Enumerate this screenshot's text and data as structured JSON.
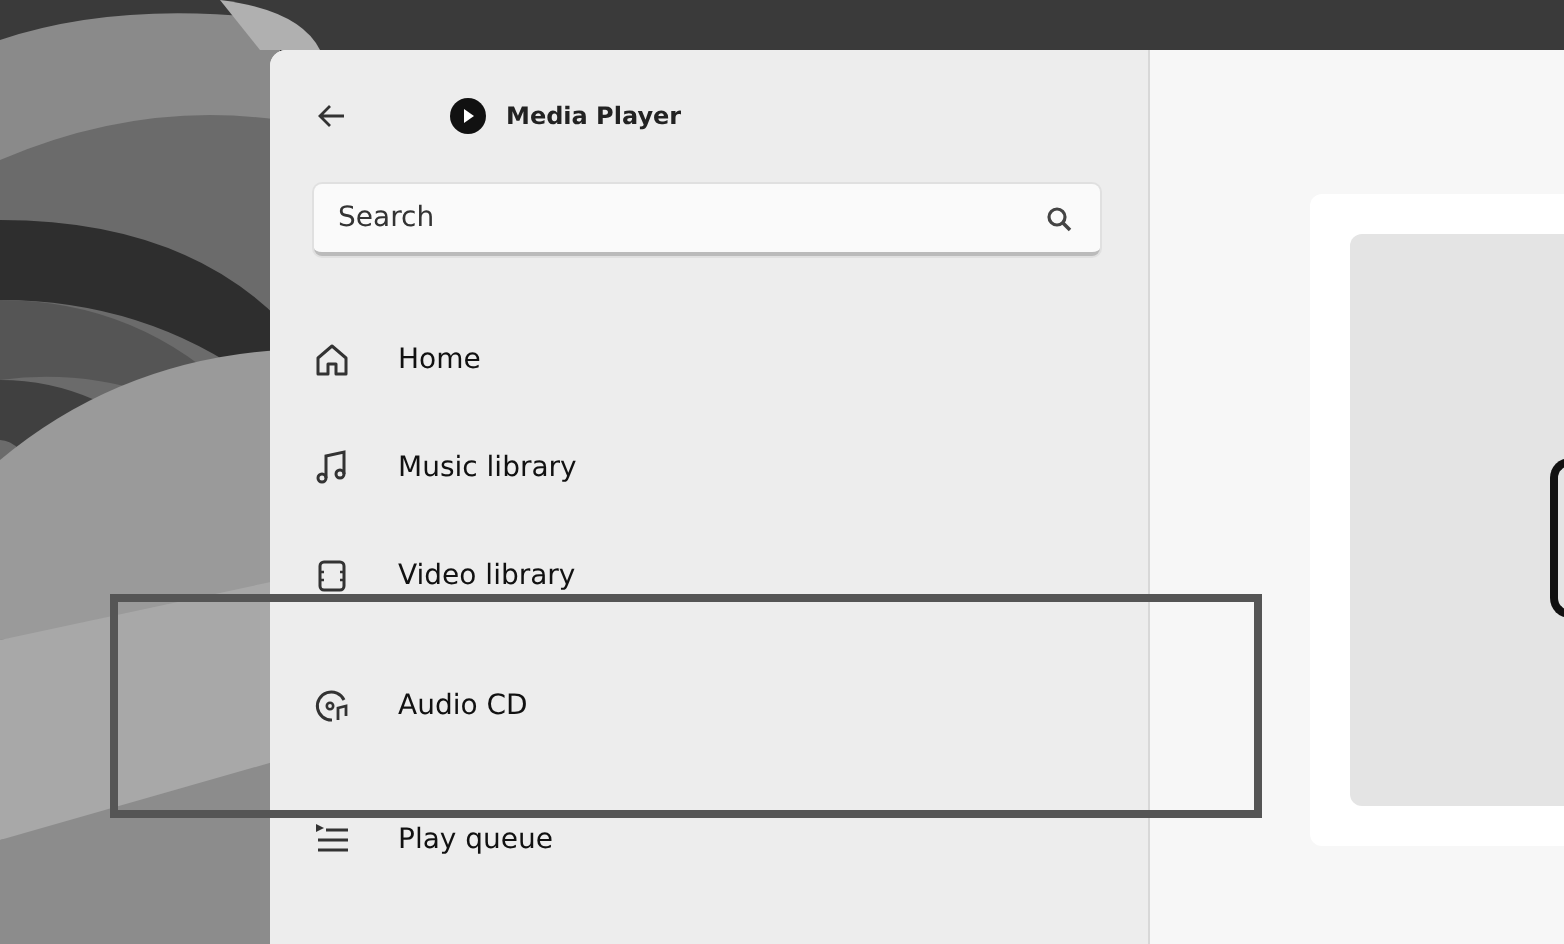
{
  "window": {
    "title": "Media Player"
  },
  "search": {
    "placeholder": "Search"
  },
  "nav": [
    {
      "label": "Home",
      "kind": "home"
    },
    {
      "label": "Music library",
      "kind": "music"
    },
    {
      "label": "Video library",
      "kind": "video"
    },
    {
      "label": "Audio CD",
      "kind": "cd"
    },
    {
      "label": "Play queue",
      "kind": "queue"
    }
  ]
}
